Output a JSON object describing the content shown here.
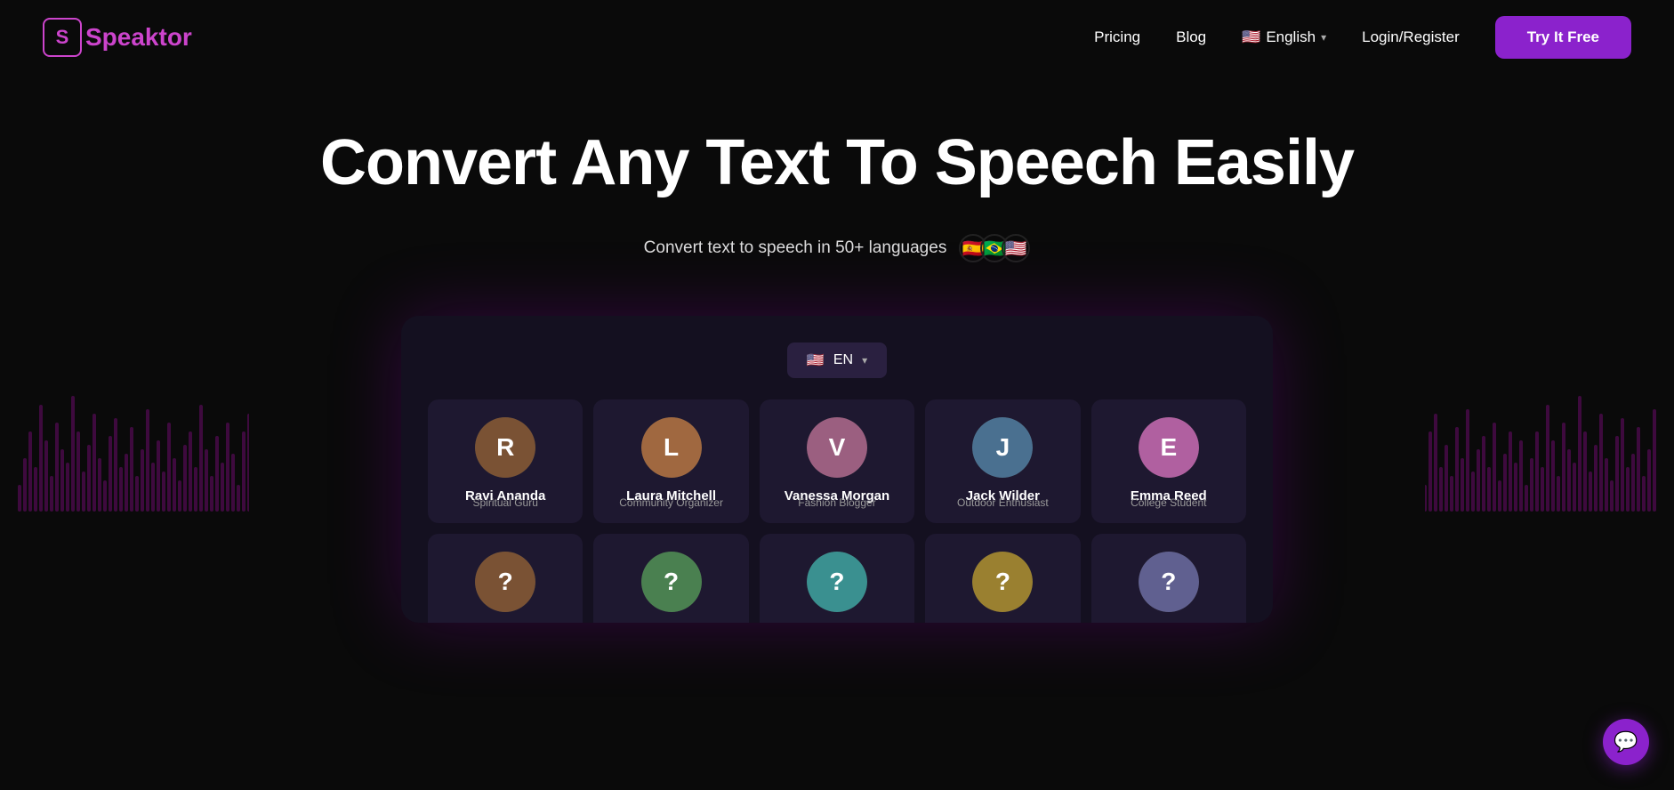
{
  "brand": {
    "logo_letter": "S",
    "logo_name": "Speaktor"
  },
  "navbar": {
    "pricing_label": "Pricing",
    "blog_label": "Blog",
    "language_label": "English",
    "login_label": "Login/Register",
    "try_label": "Try It Free"
  },
  "hero": {
    "headline": "Convert Any Text To Speech Easily",
    "subtitle": "Convert text to speech in 50+ languages",
    "flags": [
      "🇪🇸",
      "🇧🇷",
      "🇺🇸"
    ]
  },
  "app": {
    "lang_selector": "EN",
    "voices_row1": [
      {
        "name": "Ravi Ananda",
        "role": "Spiritual Guru",
        "color": "#6b4a2a",
        "initial": "R"
      },
      {
        "name": "Laura Mitchell",
        "role": "Community Organizer",
        "color": "#8b5e3c",
        "initial": "L"
      },
      {
        "name": "Vanessa Morgan",
        "role": "Fashion Blogger",
        "color": "#7a4f6d",
        "initial": "V"
      },
      {
        "name": "Jack Wilder",
        "role": "Outdoor Enthusiast",
        "color": "#3a5c7a",
        "initial": "J"
      },
      {
        "name": "Emma Reed",
        "role": "College Student",
        "color": "#8b3a7a",
        "initial": "E"
      }
    ],
    "voices_row2": [
      {
        "name": "",
        "role": "",
        "color": "#6b4a2a",
        "initial": "?"
      },
      {
        "name": "",
        "role": "",
        "color": "#4a6b4a",
        "initial": "?"
      },
      {
        "name": "",
        "role": "",
        "color": "#3a7a7a",
        "initial": "?"
      },
      {
        "name": "",
        "role": "",
        "color": "#7a6b3a",
        "initial": "?"
      },
      {
        "name": "",
        "role": "",
        "color": "#5a5a7a",
        "initial": "?"
      }
    ]
  },
  "chat": {
    "icon": "💬"
  }
}
